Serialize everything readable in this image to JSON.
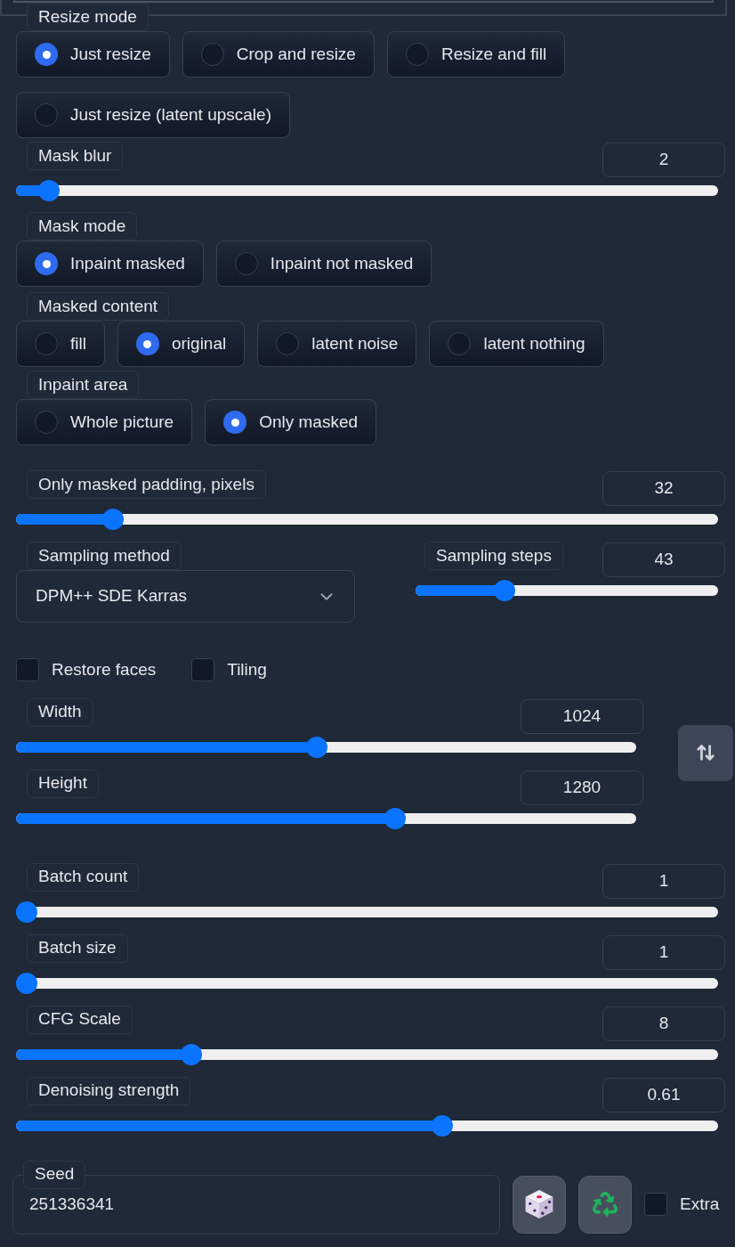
{
  "resize_mode": {
    "label": "Resize mode",
    "options": [
      {
        "label": "Just resize",
        "selected": true
      },
      {
        "label": "Crop and resize",
        "selected": false
      },
      {
        "label": "Resize and fill",
        "selected": false
      },
      {
        "label": "Just resize (latent upscale)",
        "selected": false
      }
    ]
  },
  "mask_blur": {
    "label": "Mask blur",
    "value": "2",
    "level": 0.033
  },
  "mask_mode": {
    "label": "Mask mode",
    "options": [
      {
        "label": "Inpaint masked",
        "selected": true
      },
      {
        "label": "Inpaint not masked",
        "selected": false
      }
    ]
  },
  "masked_content": {
    "label": "Masked content",
    "options": [
      {
        "label": "fill",
        "selected": false
      },
      {
        "label": "original",
        "selected": true
      },
      {
        "label": "latent noise",
        "selected": false
      },
      {
        "label": "latent nothing",
        "selected": false
      }
    ]
  },
  "inpaint_area": {
    "label": "Inpaint area",
    "options": [
      {
        "label": "Whole picture",
        "selected": false
      },
      {
        "label": "Only masked",
        "selected": true
      }
    ]
  },
  "only_masked_padding": {
    "label": "Only masked padding, pixels",
    "value": "32",
    "level": 0.127
  },
  "sampling_method": {
    "label": "Sampling method",
    "value": "DPM++ SDE Karras"
  },
  "sampling_steps": {
    "label": "Sampling steps",
    "value": "43",
    "level": 0.278
  },
  "options": [
    {
      "label": "Restore faces",
      "checked": false
    },
    {
      "label": "Tiling",
      "checked": false
    }
  ],
  "width": {
    "label": "Width",
    "value": "1024",
    "level": 0.485
  },
  "height": {
    "label": "Height",
    "value": "1280",
    "level": 0.615
  },
  "batch_count": {
    "label": "Batch count",
    "value": "1",
    "level": 0
  },
  "batch_size": {
    "label": "Batch size",
    "value": "1",
    "level": 0
  },
  "cfg_scale": {
    "label": "CFG Scale",
    "value": "8",
    "level": 0.242
  },
  "denoising_strength": {
    "label": "Denoising strength",
    "value": "0.61",
    "level": 0.61
  },
  "seed": {
    "label": "Seed",
    "value": "251336341",
    "extra": {
      "label": "Extra",
      "checked": false
    }
  }
}
